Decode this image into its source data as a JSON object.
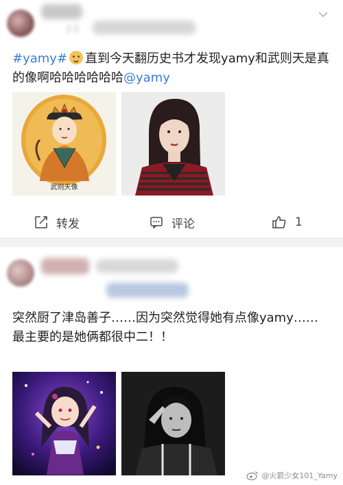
{
  "post1": {
    "username": "23",
    "topic": "#yamy#",
    "emoji": "doge-emoji",
    "text_part1": "直到今天翻历史书才发现yamy和武则天是真的像啊哈哈哈哈哈哈",
    "mention": "@yamy",
    "images": [
      {
        "caption": "武则天像",
        "desc": "empress-portrait"
      },
      {
        "desc": "girl-photo"
      }
    ],
    "actions": {
      "repost_label": "转发",
      "comment_label": "评论",
      "like_count": "1"
    }
  },
  "post2": {
    "text_line1": "突然厨了津岛善子……因为突然觉得她有点像yamy……",
    "text_line2": "最主要的是她俩都很中二！！",
    "images": [
      {
        "desc": "anime-character"
      },
      {
        "desc": "girl-bw-photo"
      }
    ]
  },
  "watermark": {
    "text": "@火箭少女101_Yamy"
  },
  "colors": {
    "link": "#3a7bd5",
    "separator": "#f2f2f2",
    "text": "#222222"
  }
}
